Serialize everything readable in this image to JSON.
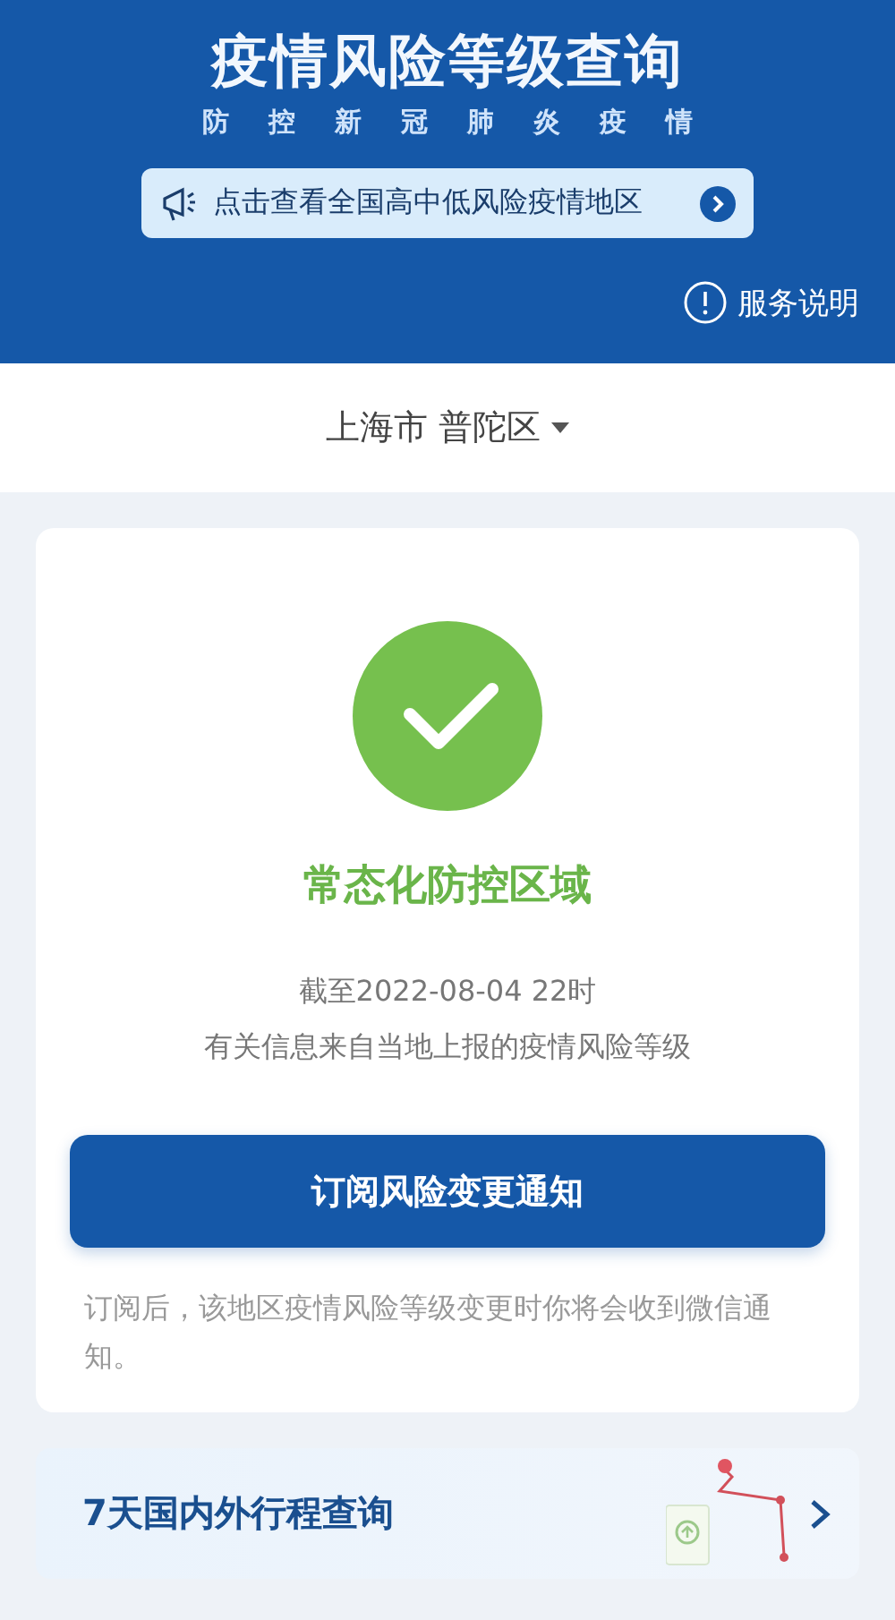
{
  "header": {
    "title": "疫情风险等级查询",
    "subtitle": "防控新冠肺炎疫情",
    "banner": "点击查看全国高中低风险疫情地区",
    "service_link": "服务说明"
  },
  "location": {
    "city": "上海市",
    "district": "普陀区"
  },
  "risk_card": {
    "level": "常态化防控区域",
    "updated": "截至2022-08-04 22时",
    "source": "有关信息来自当地上报的疫情风险等级",
    "subscribe_button": "订阅风险变更通知",
    "subscribe_note": "订阅后，该地区疫情风险等级变更时你将会收到微信通知。"
  },
  "trip_card": {
    "title": "7天国内外行程查询"
  }
}
